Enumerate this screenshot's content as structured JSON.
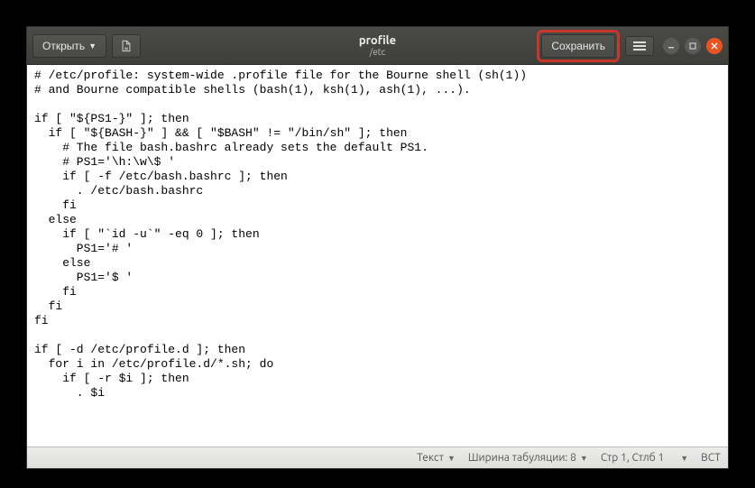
{
  "header": {
    "open_label": "Открыть",
    "save_label": "Сохранить",
    "title": "profile",
    "subtitle": "/etc"
  },
  "statusbar": {
    "syntax_label": "Текст",
    "tab_width_label": "Ширина табуляции: 8",
    "cursor_label": "Стр 1, Стлб 1",
    "insert_mode": "ВСТ"
  },
  "editor": {
    "content": "# /etc/profile: system-wide .profile file for the Bourne shell (sh(1))\n# and Bourne compatible shells (bash(1), ksh(1), ash(1), ...).\n\nif [ \"${PS1-}\" ]; then\n  if [ \"${BASH-}\" ] && [ \"$BASH\" != \"/bin/sh\" ]; then\n    # The file bash.bashrc already sets the default PS1.\n    # PS1='\\h:\\w\\$ '\n    if [ -f /etc/bash.bashrc ]; then\n      . /etc/bash.bashrc\n    fi\n  else\n    if [ \"`id -u`\" -eq 0 ]; then\n      PS1='# '\n    else\n      PS1='$ '\n    fi\n  fi\nfi\n\nif [ -d /etc/profile.d ]; then\n  for i in /etc/profile.d/*.sh; do\n    if [ -r $i ]; then\n      . $i"
  }
}
